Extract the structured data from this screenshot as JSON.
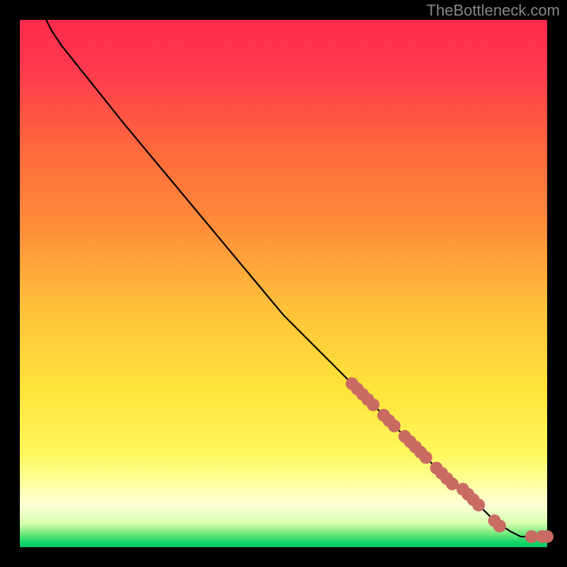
{
  "watermark": "TheBottleneck.com",
  "colors": {
    "dot_fill": "#c96b63",
    "dot_stroke": "#b85a54",
    "curve": "#000000"
  },
  "chart_data": {
    "type": "line",
    "title": "",
    "xlabel": "",
    "ylabel": "",
    "xlim": [
      0,
      100
    ],
    "ylim": [
      0,
      100
    ],
    "curve": [
      {
        "x": 5,
        "y": 100
      },
      {
        "x": 6,
        "y": 98
      },
      {
        "x": 8,
        "y": 95
      },
      {
        "x": 12,
        "y": 90
      },
      {
        "x": 20,
        "y": 80
      },
      {
        "x": 30,
        "y": 68
      },
      {
        "x": 40,
        "y": 56
      },
      {
        "x": 50,
        "y": 44
      },
      {
        "x": 60,
        "y": 34
      },
      {
        "x": 66,
        "y": 28
      },
      {
        "x": 70,
        "y": 24
      },
      {
        "x": 75,
        "y": 19
      },
      {
        "x": 80,
        "y": 14
      },
      {
        "x": 85,
        "y": 10
      },
      {
        "x": 90,
        "y": 5
      },
      {
        "x": 93,
        "y": 3
      },
      {
        "x": 95,
        "y": 2
      },
      {
        "x": 97,
        "y": 2
      },
      {
        "x": 99,
        "y": 2
      },
      {
        "x": 100,
        "y": 2
      }
    ],
    "points": [
      {
        "x": 63,
        "y": 31
      },
      {
        "x": 64,
        "y": 30
      },
      {
        "x": 65,
        "y": 29
      },
      {
        "x": 66,
        "y": 28
      },
      {
        "x": 67,
        "y": 27
      },
      {
        "x": 69,
        "y": 25
      },
      {
        "x": 70,
        "y": 24
      },
      {
        "x": 71,
        "y": 23
      },
      {
        "x": 73,
        "y": 21
      },
      {
        "x": 74,
        "y": 20
      },
      {
        "x": 75,
        "y": 19
      },
      {
        "x": 76,
        "y": 18
      },
      {
        "x": 77,
        "y": 17
      },
      {
        "x": 79,
        "y": 15
      },
      {
        "x": 80,
        "y": 14
      },
      {
        "x": 81,
        "y": 13
      },
      {
        "x": 82,
        "y": 12
      },
      {
        "x": 84,
        "y": 11
      },
      {
        "x": 85,
        "y": 10
      },
      {
        "x": 86,
        "y": 9
      },
      {
        "x": 87,
        "y": 8
      },
      {
        "x": 90,
        "y": 5
      },
      {
        "x": 91,
        "y": 4
      },
      {
        "x": 97,
        "y": 2
      },
      {
        "x": 99,
        "y": 2
      },
      {
        "x": 100,
        "y": 2
      }
    ],
    "point_radius": 9
  }
}
